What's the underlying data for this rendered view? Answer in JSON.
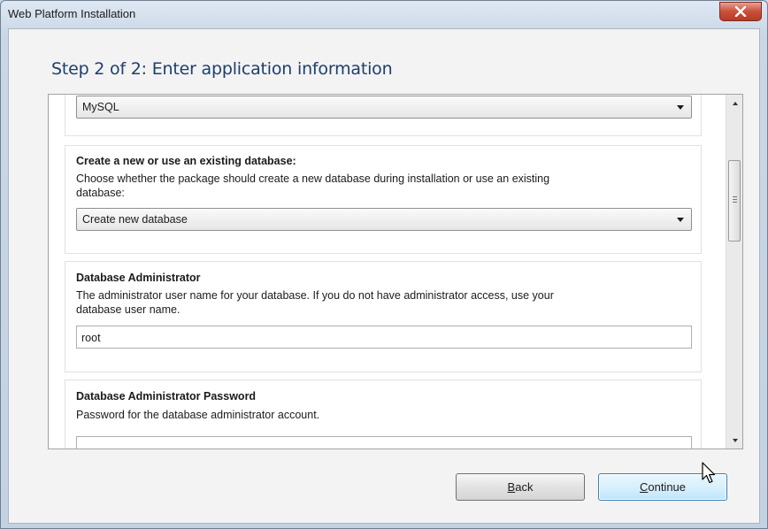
{
  "window": {
    "title": "Web Platform Installation",
    "close_icon": "close-icon"
  },
  "step_title": "Step 2 of 2: Enter application information",
  "form": {
    "db_type": {
      "selected": "MySQL"
    },
    "create_db": {
      "title": "Create a new or use an existing database:",
      "desc_line1": "Choose whether the package should create a new database during installation or use an existing",
      "desc_line2": "database:",
      "selected": "Create new database"
    },
    "db_admin": {
      "title": "Database Administrator",
      "desc_line1": "The administrator user name for your database. If you do not have administrator access, use your",
      "desc_line2": "database user name.",
      "value": "root"
    },
    "db_admin_password": {
      "title": "Database Administrator Password",
      "desc": "Password for the database administrator account.",
      "value": ""
    }
  },
  "buttons": {
    "back_mnemonic": "B",
    "back_rest": "ack",
    "continue_mnemonic": "C",
    "continue_rest": "ontinue"
  },
  "scrollbar": {
    "position_fraction": 0.15
  }
}
